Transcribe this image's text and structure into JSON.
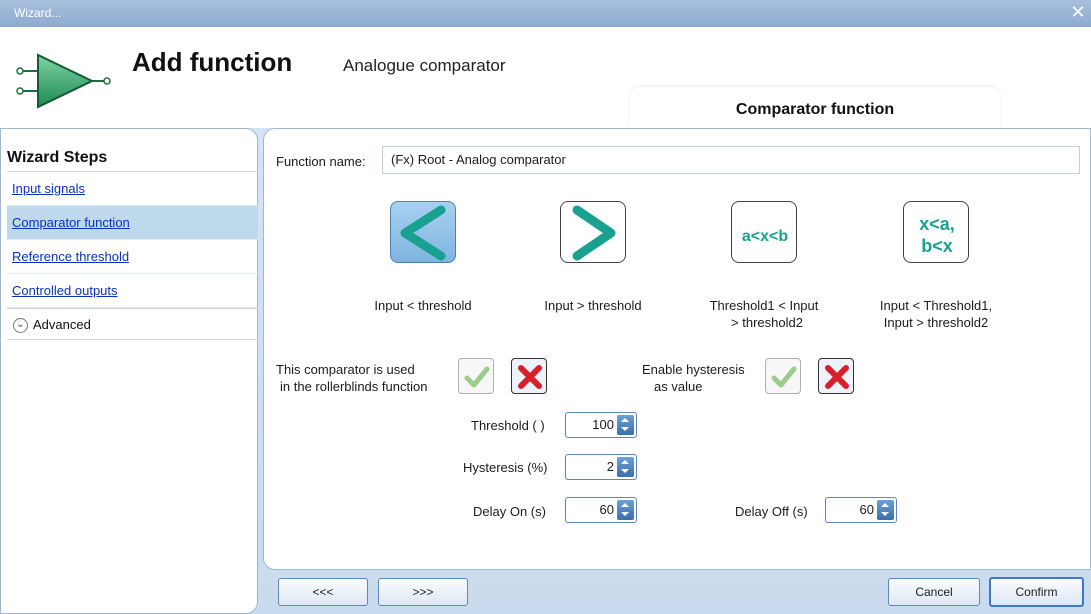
{
  "window": {
    "title": "Wizard...",
    "close_glyph": "✕"
  },
  "header": {
    "title": "Add function",
    "subtitle": "Analogue comparator",
    "tab": "Comparator function",
    "logo_icon": "comparator-triangle-icon"
  },
  "sidebar": {
    "title": "Wizard Steps",
    "items": [
      {
        "label": "Input signals",
        "active": false
      },
      {
        "label": "Comparator function",
        "active": true
      },
      {
        "label": "Reference threshold",
        "active": false
      },
      {
        "label": "Controlled outputs",
        "active": false
      }
    ],
    "advanced": "Advanced"
  },
  "form": {
    "function_name_label": "Function name:",
    "function_name_value": "(Fx) Root - Analog comparator",
    "options": [
      {
        "icon_text": "<",
        "label1": "Input < threshold",
        "label2": "",
        "selected": true
      },
      {
        "icon_text": ">",
        "label1": "Input > threshold",
        "label2": "",
        "selected": false
      },
      {
        "icon_text": "a<x<b",
        "label1": "Threshold1 < Input",
        "label2": "> threshold2",
        "selected": false
      },
      {
        "icon_text1": "x<a,",
        "icon_text2": "b<x",
        "label1": "Input < Threshold1,",
        "label2": "Input > threshold2",
        "selected": false
      }
    ],
    "rollerblinds_label1": "This comparator is used",
    "rollerblinds_label2": "in the rollerblinds function",
    "hysteresis_label1": "Enable hysteresis",
    "hysteresis_label2": "as value",
    "threshold_label": "Threshold ( )",
    "threshold_value": "100",
    "hysteresis_pct_label": "Hysteresis (%)",
    "hysteresis_pct_value": "2",
    "delay_on_label": "Delay On (s)",
    "delay_on_value": "60",
    "delay_off_label": "Delay Off (s)",
    "delay_off_value": "60"
  },
  "footer": {
    "back": "<<<",
    "next": ">>>",
    "cancel": "Cancel",
    "confirm": "Confirm"
  },
  "colors": {
    "accent": "#3c78c5",
    "link": "#0b32b9",
    "selected_bg": "#bfd9ec",
    "icon_green": "#1aa08f"
  }
}
